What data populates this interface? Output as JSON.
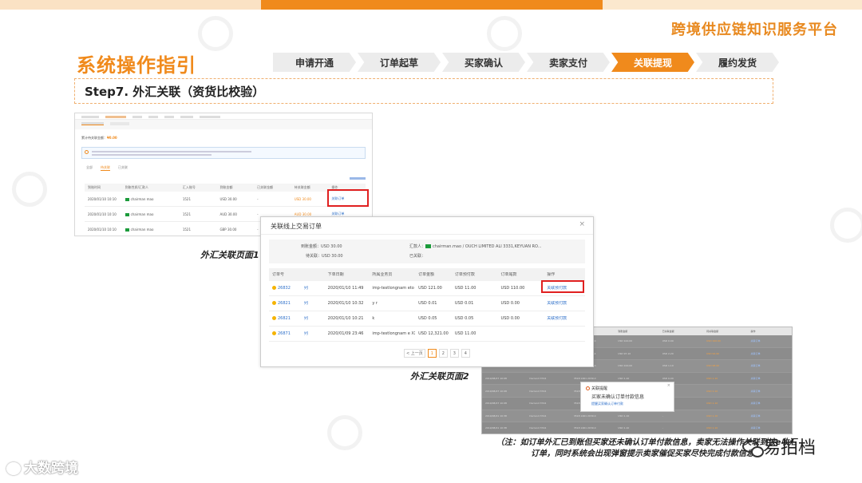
{
  "header": {
    "platform_title": "跨境供应链知识服务平台"
  },
  "section_title": "系统操作指引",
  "steps": [
    {
      "label": "申请开通",
      "active": false
    },
    {
      "label": "订单起草",
      "active": false
    },
    {
      "label": "买家确认",
      "active": false
    },
    {
      "label": "卖家支付",
      "active": false
    },
    {
      "label": "关联提现",
      "active": true
    },
    {
      "label": "履约发货",
      "active": false
    }
  ],
  "step_title": "Step7. 外汇关联（资货比校验）",
  "accent_color": "#f08a1c",
  "screenshot1": {
    "caption": "外汇关联页面1",
    "summary_label": "累计待关联金额：",
    "summary_value": "¥0.00",
    "tabs": [
      "全部",
      "待关联",
      "已关联"
    ],
    "headers": [
      "到账时间",
      "到账性质/汇款人",
      "汇入账号",
      "到账金额",
      "已关联金额",
      "待关联金额",
      "操作"
    ],
    "rows": [
      {
        "time": "2020/01/10 10:10",
        "payer": "chairman mao",
        "account": "1521",
        "amount": "USD 30.00",
        "linked": "-",
        "pending": "USD 30.00",
        "action": "关联订单"
      },
      {
        "time": "2020/01/10 10:10",
        "payer": "chairman mao",
        "account": "1521",
        "amount": "AUD 30.00",
        "linked": "-",
        "pending": "AUD 30.00",
        "action": "关联订单"
      },
      {
        "time": "2020/01/10 10:10",
        "payer": "chairman mao",
        "account": "1521",
        "amount": "GBP 30.00",
        "linked": "-",
        "pending": "GBP 30.00",
        "action": "关联订单"
      }
    ]
  },
  "dialog": {
    "title": "关联线上交易订单",
    "close": "×",
    "received_label": "到账金额：",
    "received_value": "USD 30.00",
    "pending_label": "待关联：",
    "pending_value": "USD 30.00",
    "payer_label": "汇款人：",
    "payer_value": "chairman.mao /        OUCH LIMITED ALI 3331,KEYUAN RO...",
    "linked_label": "已关联：",
    "linked_value": "",
    "headers": [
      "订单号",
      "",
      "下单日期",
      "所属业务员",
      "订单金额",
      "订单预付款",
      "订单尾款",
      "操作"
    ],
    "rows": [
      {
        "order": "26832",
        "tag": "列",
        "date": "2020/01/10 11:49",
        "rep": "imp-testlongnam eto     XXXkg dm",
        "amount": "USD 121.00",
        "prepay": "USD 11.00",
        "balance": "USD 110.00",
        "action": "关联预付款"
      },
      {
        "order": "26821",
        "tag": "列",
        "date": "2020/01/10 10:32",
        "rep": "y         r",
        "amount": "USD 0.01",
        "prepay": "USD 0.01",
        "balance": "USD 0.00",
        "action": "关联预付款"
      },
      {
        "order": "26821",
        "tag": "列",
        "date": "2020/01/10 10:21",
        "rep": "               k",
        "amount": "USD 0.05",
        "prepay": "USD 0.05",
        "balance": "USD 0.00",
        "action": "关联预付款"
      },
      {
        "order": "26871",
        "tag": "列",
        "date": "2020/01/09 23:46",
        "rep": "imp-testlongnam e       XXXkg dm",
        "amount": "USD 12,321.00",
        "prepay": "USD 11.00",
        "balance": "",
        "action": ""
      }
    ],
    "pager": [
      "< 上一页",
      "1",
      "2",
      "3",
      "4"
    ],
    "caption": "外汇关联页面2"
  },
  "screenshot3": {
    "headers": [
      "到账时间",
      "到账性质/汇款人",
      "汇入账号",
      "到账金额",
      "已关联金额",
      "待关联金额",
      "操作"
    ],
    "rows": [
      {
        "time": "2019/09/14 17:17",
        "payer": "Derrand 3744",
        "account": "3518 1461 2039.0",
        "amount": "USD 100.00",
        "linked": "USD 0.00",
        "pending": "USD 100.00",
        "action": "关联订单"
      },
      {
        "time": "2019/09/11 10:18",
        "payer": "chairman mao",
        "account": "3548 2032 3032.4",
        "amount": "USD 97.10",
        "linked": "USD 2.20",
        "pending": "USD 94.90",
        "action": "关联订单"
      },
      {
        "time": "2019/08/27 10:09",
        "payer": "Derrand 3744",
        "account": "3518 1461 2039.0",
        "amount": "USD 100.00",
        "linked": "USD 1.10",
        "pending": "USD 98.90",
        "action": "关联订单"
      },
      {
        "time": "2019/08/27 10:08",
        "payer": "Derrand 3744",
        "account": "3518 1461 2039.0",
        "amount": "USD 1.10",
        "linked": "USD 0.00",
        "pending": "USD 1.10",
        "action": "关联订单"
      },
      {
        "time": "2019/08/27 10:08",
        "payer": "Derrand 3744",
        "account": "3518 1461 2039.0",
        "amount": "USD 1.10",
        "linked": "USD 0.00",
        "pending": "USD 1.10",
        "action": "关联订单"
      },
      {
        "time": "2019/08/27 10:08",
        "payer": "Derrand 3744",
        "account": "3518 1461 2039.0",
        "amount": "USD 1.10",
        "linked": "USD 0.00",
        "pending": "USD 1.10",
        "action": "关联订单"
      },
      {
        "time": "2019/08/21 10:38",
        "payer": "Derrand 3744",
        "account": "3518 1461 2039.0",
        "amount": "USD 1.10",
        "linked": "-",
        "pending": "USD 1.10",
        "action": "关联订单"
      },
      {
        "time": "2019/08/21 10:38",
        "payer": "Derrand 3744",
        "account": "3518 1461 2039.0",
        "amount": "USD 1.10",
        "linked": "-",
        "pending": "USD 1.10",
        "action": "关联订单"
      }
    ],
    "modal_title": "关联提醒",
    "modal_text": "买家未确认订单付款信息",
    "modal_link": "提醒买家确认订单付款",
    "modal_close": "×"
  },
  "note": "（注：如订单外汇已到账但买家还未确认订单付款信息，卖家无法操作关联到该e收汇订单，同时系统会出现弹窗提示卖家催促买家尽快完成付款信息）",
  "footer": {
    "left_logo": "大数跨境",
    "wechat_account": "易拍档"
  }
}
